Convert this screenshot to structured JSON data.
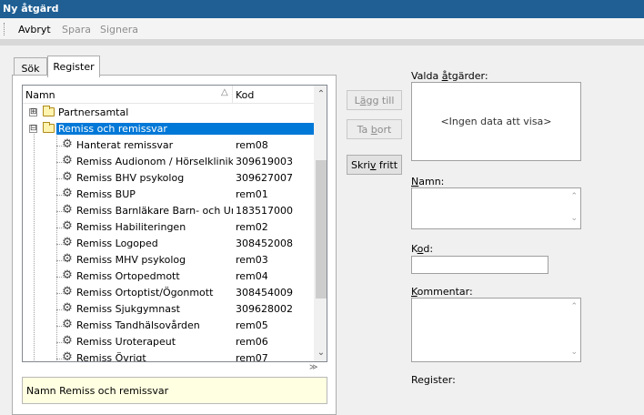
{
  "window": {
    "title": "Ny åtgärd"
  },
  "toolbar": {
    "cancel": "Avbryt",
    "save": "Spara",
    "sign": "Signera"
  },
  "tabs": {
    "search": "Sök",
    "register": "Register"
  },
  "tree": {
    "col_name": "Namn",
    "col_code": "Kod",
    "sort_indicator": "△",
    "nodes": [
      {
        "label": "Partnersamtal",
        "code": "",
        "expander": "⊞"
      },
      {
        "label": "Remiss och remissvar",
        "code": "",
        "expander": "⊟"
      }
    ],
    "items": [
      {
        "label": "Hanterat remissvar",
        "code": "rem08"
      },
      {
        "label": "Remiss Audionom / Hörselklinik / Ö...",
        "code": "309619003"
      },
      {
        "label": "Remiss BHV psykolog",
        "code": "309627007"
      },
      {
        "label": "Remiss BUP",
        "code": "rem01"
      },
      {
        "label": "Remiss Barnläkare Barn- och Ungd...",
        "code": "183517000"
      },
      {
        "label": "Remiss Habiliteringen",
        "code": "rem02"
      },
      {
        "label": "Remiss Logoped",
        "code": "308452008"
      },
      {
        "label": "Remiss MHV psykolog",
        "code": "rem03"
      },
      {
        "label": "Remiss Ortopedmott",
        "code": "rem04"
      },
      {
        "label": "Remiss Ortoptist/Ögonmott",
        "code": "308454009"
      },
      {
        "label": "Remiss Sjukgymnast",
        "code": "309628002"
      },
      {
        "label": "Remiss Tandhälsovården",
        "code": "rem05"
      },
      {
        "label": "Remiss Uroterapeut",
        "code": "rem06"
      },
      {
        "label": "Remiss Övrigt",
        "code": "rem07"
      }
    ]
  },
  "info": {
    "text": "Namn Remiss och remissvar"
  },
  "actions": {
    "add_pre": "L",
    "add_u": "ä",
    "add_post": "gg till",
    "remove_pre": "Ta ",
    "remove_u": "b",
    "remove_post": "ort",
    "free_pre": "Skri",
    "free_u": "v",
    "free_post": " fritt"
  },
  "right": {
    "selected_pre": "Valda ",
    "selected_u": "å",
    "selected_post": "tgärder:",
    "empty": "<Ingen data att visa>",
    "name_pre": "",
    "name_u": "N",
    "name_post": "amn:",
    "code_pre": "K",
    "code_u": "o",
    "code_post": "d:",
    "comment_pre": "",
    "comment_u": "K",
    "comment_post": "ommentar:",
    "register": "Register:"
  },
  "colors": {
    "title_bg": "#1f5f94",
    "selection": "#0078d7",
    "info_bg": "#ffffe1"
  }
}
